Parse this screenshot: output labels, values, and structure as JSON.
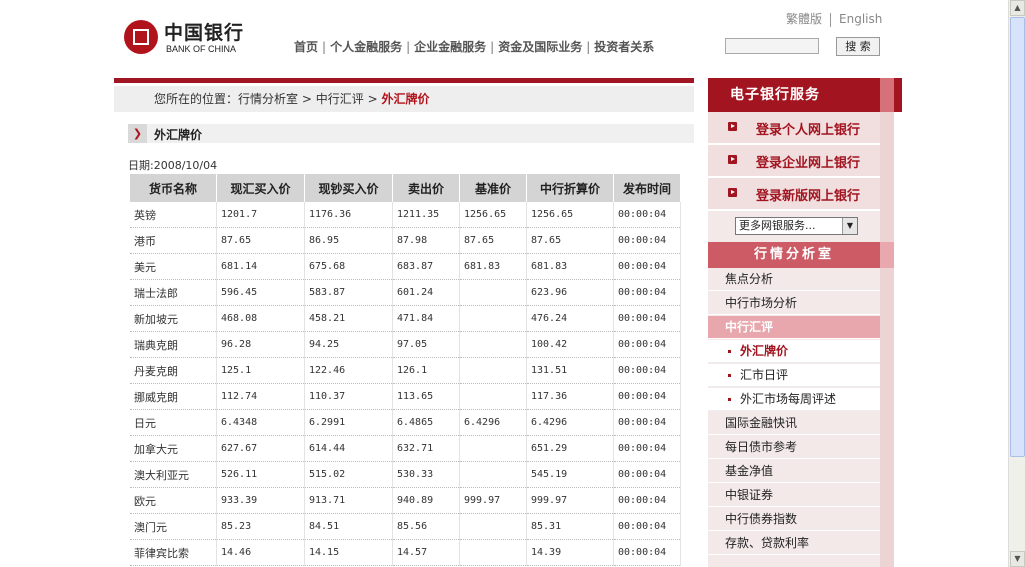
{
  "header": {
    "logo_cn": "中国银行",
    "logo_en": "BANK OF CHINA",
    "nav": [
      "首页",
      "个人金融服务",
      "企业金融服务",
      "资金及国际业务",
      "投资者关系"
    ],
    "lang_trad": "繁體版",
    "lang_en": "English",
    "search_label": "搜 索"
  },
  "breadcrumb": {
    "prefix": "您所在的位置：",
    "items": [
      "行情分析室",
      "中行汇评"
    ],
    "current": "外汇牌价",
    "sep": ">"
  },
  "section": {
    "title": "外汇牌价",
    "date": "日期:2008/10/04"
  },
  "table": {
    "headers": [
      "货币名称",
      "现汇买入价",
      "现钞买入价",
      "卖出价",
      "基准价",
      "中行折算价",
      "发布时间"
    ],
    "rows": [
      [
        "英镑",
        "1201.7",
        "1176.36",
        "1211.35",
        "1256.65",
        "1256.65",
        "00:00:04"
      ],
      [
        "港币",
        "87.65",
        "86.95",
        "87.98",
        "87.65",
        "87.65",
        "00:00:04"
      ],
      [
        "美元",
        "681.14",
        "675.68",
        "683.87",
        "681.83",
        "681.83",
        "00:00:04"
      ],
      [
        "瑞士法郎",
        "596.45",
        "583.87",
        "601.24",
        "",
        "623.96",
        "00:00:04"
      ],
      [
        "新加坡元",
        "468.08",
        "458.21",
        "471.84",
        "",
        "476.24",
        "00:00:04"
      ],
      [
        "瑞典克朗",
        "96.28",
        "94.25",
        "97.05",
        "",
        "100.42",
        "00:00:04"
      ],
      [
        "丹麦克朗",
        "125.1",
        "122.46",
        "126.1",
        "",
        "131.51",
        "00:00:04"
      ],
      [
        "挪威克朗",
        "112.74",
        "110.37",
        "113.65",
        "",
        "117.36",
        "00:00:04"
      ],
      [
        "日元",
        "6.4348",
        "6.2991",
        "6.4865",
        "6.4296",
        "6.4296",
        "00:00:04"
      ],
      [
        "加拿大元",
        "627.67",
        "614.44",
        "632.71",
        "",
        "651.29",
        "00:00:04"
      ],
      [
        "澳大利亚元",
        "526.11",
        "515.02",
        "530.33",
        "",
        "545.19",
        "00:00:04"
      ],
      [
        "欧元",
        "933.39",
        "913.71",
        "940.89",
        "999.97",
        "999.97",
        "00:00:04"
      ],
      [
        "澳门元",
        "85.23",
        "84.51",
        "85.56",
        "",
        "85.31",
        "00:00:04"
      ],
      [
        "菲律宾比索",
        "14.46",
        "14.15",
        "14.57",
        "",
        "14.39",
        "00:00:04"
      ]
    ]
  },
  "sidebar": {
    "ebank_title": "电子银行服务",
    "logins": [
      "登录个人网上银行",
      "登录企业网上银行",
      "登录新版网上银行"
    ],
    "more_select": "更多网银服务...",
    "analysis_title": "行情分析室",
    "items_top": [
      "焦点分析",
      "中行市场分析"
    ],
    "active_item": "中行汇评",
    "children": [
      "外汇牌价",
      "汇市日评",
      "外汇市场每周评述"
    ],
    "items_bottom": [
      "国际金融快讯",
      "每日债市参考",
      "基金净值",
      "中银证券",
      "中行债券指数",
      "存款、贷款利率"
    ]
  },
  "colors": {
    "brand": "#a11420",
    "accent_light": "#e8a7ad"
  }
}
